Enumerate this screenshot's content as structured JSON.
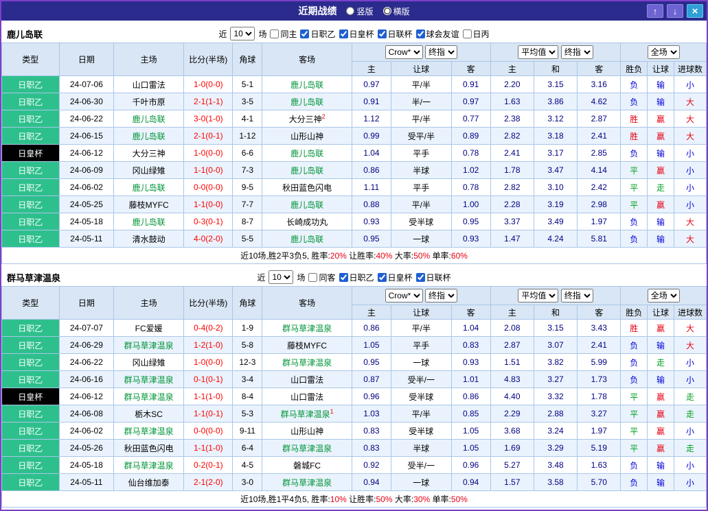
{
  "titlebar": {
    "title": "近期战绩",
    "radios": [
      {
        "label": "竖版",
        "checked": false
      },
      {
        "label": "横版",
        "checked": true
      }
    ],
    "buttons": [
      {
        "name": "up",
        "glyph": "↑"
      },
      {
        "name": "down",
        "glyph": "↓"
      },
      {
        "name": "close",
        "glyph": "×"
      }
    ]
  },
  "filter_labels": {
    "near": "近",
    "games": "场"
  },
  "table_header": {
    "type": "类型",
    "date": "日期",
    "home": "主场",
    "score": "比分(半场)",
    "corner": "角球",
    "away": "客场",
    "asian_selects": [
      "Crow*",
      "终指"
    ],
    "euro_selects": [
      "平均值",
      "终指"
    ],
    "scope_select": "全场",
    "sub": [
      "主",
      "让球",
      "客",
      "主",
      "和",
      "客",
      "胜负",
      "让球",
      "进球数"
    ]
  },
  "colors": {
    "accent_green": "#2ec08c",
    "cup_black": "#000000",
    "win_red": "#e60012",
    "lose_blue": "#0000d8",
    "draw_green": "#00a020",
    "titlebar_bg": "#2b2b8e"
  },
  "sections": [
    {
      "team": "鹿儿岛联",
      "count": "10",
      "same": {
        "label": "同主",
        "checked": false
      },
      "leagues": [
        {
          "label": "日职乙",
          "checked": true
        },
        {
          "label": "日皇杯",
          "checked": true
        },
        {
          "label": "日联杯",
          "checked": true
        },
        {
          "label": "球会友谊",
          "checked": true
        },
        {
          "label": "日丙",
          "checked": false
        }
      ],
      "rows": [
        {
          "league": "日职乙",
          "date": "24-07-06",
          "home": "山口雷法",
          "home_focus": false,
          "home_sup": "",
          "score": "1-0(0-0)",
          "corner": "5-1",
          "away": "鹿儿岛联",
          "away_focus": true,
          "away_sup": "",
          "asian": [
            "0.97",
            "平/半",
            "0.91"
          ],
          "euro": [
            "2.20",
            "3.15",
            "3.16"
          ],
          "result": "负",
          "handicap_result": "输",
          "goals": "小"
        },
        {
          "league": "日职乙",
          "date": "24-06-30",
          "home": "千叶市原",
          "home_focus": false,
          "home_sup": "",
          "score": "2-1(1-1)",
          "corner": "3-5",
          "away": "鹿儿岛联",
          "away_focus": true,
          "away_sup": "",
          "asian": [
            "0.91",
            "半/一",
            "0.97"
          ],
          "euro": [
            "1.63",
            "3.86",
            "4.62"
          ],
          "result": "负",
          "handicap_result": "输",
          "goals": "大"
        },
        {
          "league": "日职乙",
          "date": "24-06-22",
          "home": "鹿儿岛联",
          "home_focus": true,
          "home_sup": "",
          "score": "3-0(1-0)",
          "corner": "4-1",
          "away": "大分三神",
          "away_focus": false,
          "away_sup": "2",
          "asian": [
            "1.12",
            "平/半",
            "0.77"
          ],
          "euro": [
            "2.38",
            "3.12",
            "2.87"
          ],
          "result": "胜",
          "handicap_result": "赢",
          "goals": "大"
        },
        {
          "league": "日职乙",
          "date": "24-06-15",
          "home": "鹿儿岛联",
          "home_focus": true,
          "home_sup": "",
          "score": "2-1(0-1)",
          "corner": "1-12",
          "away": "山形山神",
          "away_focus": false,
          "away_sup": "",
          "asian": [
            "0.99",
            "受平/半",
            "0.89"
          ],
          "euro": [
            "2.82",
            "3.18",
            "2.41"
          ],
          "result": "胜",
          "handicap_result": "赢",
          "goals": "大"
        },
        {
          "league": "日皇杯",
          "date": "24-06-12",
          "home": "大分三神",
          "home_focus": false,
          "home_sup": "",
          "score": "1-0(0-0)",
          "corner": "6-6",
          "away": "鹿儿岛联",
          "away_focus": true,
          "away_sup": "",
          "asian": [
            "1.04",
            "平手",
            "0.78"
          ],
          "euro": [
            "2.41",
            "3.17",
            "2.85"
          ],
          "result": "负",
          "handicap_result": "输",
          "goals": "小"
        },
        {
          "league": "日职乙",
          "date": "24-06-09",
          "home": "冈山绿雉",
          "home_focus": false,
          "home_sup": "",
          "score": "1-1(0-0)",
          "corner": "7-3",
          "away": "鹿儿岛联",
          "away_focus": true,
          "away_sup": "",
          "asian": [
            "0.86",
            "半球",
            "1.02"
          ],
          "euro": [
            "1.78",
            "3.47",
            "4.14"
          ],
          "result": "平",
          "handicap_result": "赢",
          "goals": "小"
        },
        {
          "league": "日职乙",
          "date": "24-06-02",
          "home": "鹿儿岛联",
          "home_focus": true,
          "home_sup": "",
          "score": "0-0(0-0)",
          "corner": "9-5",
          "away": "秋田蓝色闪电",
          "away_focus": false,
          "away_sup": "",
          "asian": [
            "1.11",
            "平手",
            "0.78"
          ],
          "euro": [
            "2.82",
            "3.10",
            "2.42"
          ],
          "result": "平",
          "handicap_result": "走",
          "goals": "小"
        },
        {
          "league": "日职乙",
          "date": "24-05-25",
          "home": "藤枝MYFC",
          "home_focus": false,
          "home_sup": "",
          "score": "1-1(0-0)",
          "corner": "7-7",
          "away": "鹿儿岛联",
          "away_focus": true,
          "away_sup": "",
          "asian": [
            "0.88",
            "平/半",
            "1.00"
          ],
          "euro": [
            "2.28",
            "3.19",
            "2.98"
          ],
          "result": "平",
          "handicap_result": "赢",
          "goals": "小"
        },
        {
          "league": "日职乙",
          "date": "24-05-18",
          "home": "鹿儿岛联",
          "home_focus": true,
          "home_sup": "",
          "score": "0-3(0-1)",
          "corner": "8-7",
          "away": "长崎成功丸",
          "away_focus": false,
          "away_sup": "",
          "asian": [
            "0.93",
            "受半球",
            "0.95"
          ],
          "euro": [
            "3.37",
            "3.49",
            "1.97"
          ],
          "result": "负",
          "handicap_result": "输",
          "goals": "大"
        },
        {
          "league": "日职乙",
          "date": "24-05-11",
          "home": "清水鼓动",
          "home_focus": false,
          "home_sup": "",
          "score": "4-0(2-0)",
          "corner": "5-5",
          "away": "鹿儿岛联",
          "away_focus": true,
          "away_sup": "",
          "asian": [
            "0.95",
            "一球",
            "0.93"
          ],
          "euro": [
            "1.47",
            "4.24",
            "5.81"
          ],
          "result": "负",
          "handicap_result": "输",
          "goals": "大"
        }
      ],
      "summary": {
        "prefix": "近10场,胜2平3负5,",
        "stats": [
          {
            "label": "胜率:",
            "value": "20%"
          },
          {
            "label": " 让胜率:",
            "value": "40%"
          },
          {
            "label": " 大率:",
            "value": "50%"
          },
          {
            "label": " 单率:",
            "value": "60%"
          }
        ]
      }
    },
    {
      "team": "群马草津温泉",
      "count": "10",
      "same": {
        "label": "同客",
        "checked": false
      },
      "leagues": [
        {
          "label": "日职乙",
          "checked": true
        },
        {
          "label": "日皇杯",
          "checked": true
        },
        {
          "label": "日联杯",
          "checked": true
        }
      ],
      "rows": [
        {
          "league": "日职乙",
          "date": "24-07-07",
          "home": "FC爱媛",
          "home_focus": false,
          "home_sup": "",
          "score": "0-4(0-2)",
          "corner": "1-9",
          "away": "群马草津温泉",
          "away_focus": true,
          "away_sup": "",
          "asian": [
            "0.86",
            "平/半",
            "1.04"
          ],
          "euro": [
            "2.08",
            "3.15",
            "3.43"
          ],
          "result": "胜",
          "handicap_result": "赢",
          "goals": "大"
        },
        {
          "league": "日职乙",
          "date": "24-06-29",
          "home": "群马草津温泉",
          "home_focus": true,
          "home_sup": "",
          "score": "1-2(1-0)",
          "corner": "5-8",
          "away": "藤枝MYFC",
          "away_focus": false,
          "away_sup": "",
          "asian": [
            "1.05",
            "平手",
            "0.83"
          ],
          "euro": [
            "2.87",
            "3.07",
            "2.41"
          ],
          "result": "负",
          "handicap_result": "输",
          "goals": "大"
        },
        {
          "league": "日职乙",
          "date": "24-06-22",
          "home": "冈山绿雉",
          "home_focus": false,
          "home_sup": "",
          "score": "1-0(0-0)",
          "corner": "12-3",
          "away": "群马草津温泉",
          "away_focus": true,
          "away_sup": "",
          "asian": [
            "0.95",
            "一球",
            "0.93"
          ],
          "euro": [
            "1.51",
            "3.82",
            "5.99"
          ],
          "result": "负",
          "handicap_result": "走",
          "goals": "小"
        },
        {
          "league": "日职乙",
          "date": "24-06-16",
          "home": "群马草津温泉",
          "home_focus": true,
          "home_sup": "",
          "score": "0-1(0-1)",
          "corner": "3-4",
          "away": "山口雷法",
          "away_focus": false,
          "away_sup": "",
          "asian": [
            "0.87",
            "受半/一",
            "1.01"
          ],
          "euro": [
            "4.83",
            "3.27",
            "1.73"
          ],
          "result": "负",
          "handicap_result": "输",
          "goals": "小"
        },
        {
          "league": "日皇杯",
          "date": "24-06-12",
          "home": "群马草津温泉",
          "home_focus": true,
          "home_sup": "",
          "score": "1-1(1-0)",
          "corner": "8-4",
          "away": "山口雷法",
          "away_focus": false,
          "away_sup": "",
          "asian": [
            "0.96",
            "受半球",
            "0.86"
          ],
          "euro": [
            "4.40",
            "3.32",
            "1.78"
          ],
          "result": "平",
          "handicap_result": "赢",
          "goals": "走"
        },
        {
          "league": "日职乙",
          "date": "24-06-08",
          "home": "栃木SC",
          "home_focus": false,
          "home_sup": "",
          "score": "1-1(0-1)",
          "corner": "5-3",
          "away": "群马草津温泉",
          "away_focus": true,
          "away_sup": "1",
          "asian": [
            "1.03",
            "平/半",
            "0.85"
          ],
          "euro": [
            "2.29",
            "2.88",
            "3.27"
          ],
          "result": "平",
          "handicap_result": "赢",
          "goals": "走"
        },
        {
          "league": "日职乙",
          "date": "24-06-02",
          "home": "群马草津温泉",
          "home_focus": true,
          "home_sup": "",
          "score": "0-0(0-0)",
          "corner": "9-11",
          "away": "山形山神",
          "away_focus": false,
          "away_sup": "",
          "asian": [
            "0.83",
            "受半球",
            "1.05"
          ],
          "euro": [
            "3.68",
            "3.24",
            "1.97"
          ],
          "result": "平",
          "handicap_result": "赢",
          "goals": "小"
        },
        {
          "league": "日职乙",
          "date": "24-05-26",
          "home": "秋田蓝色闪电",
          "home_focus": false,
          "home_sup": "",
          "score": "1-1(1-0)",
          "corner": "6-4",
          "away": "群马草津温泉",
          "away_focus": true,
          "away_sup": "",
          "asian": [
            "0.83",
            "半球",
            "1.05"
          ],
          "euro": [
            "1.69",
            "3.29",
            "5.19"
          ],
          "result": "平",
          "handicap_result": "赢",
          "goals": "走"
        },
        {
          "league": "日职乙",
          "date": "24-05-18",
          "home": "群马草津温泉",
          "home_focus": true,
          "home_sup": "",
          "score": "0-2(0-1)",
          "corner": "4-5",
          "away": "磐城FC",
          "away_focus": false,
          "away_sup": "",
          "asian": [
            "0.92",
            "受半/一",
            "0.96"
          ],
          "euro": [
            "5.27",
            "3.48",
            "1.63"
          ],
          "result": "负",
          "handicap_result": "输",
          "goals": "小"
        },
        {
          "league": "日职乙",
          "date": "24-05-11",
          "home": "仙台维加泰",
          "home_focus": false,
          "home_sup": "",
          "score": "2-1(2-0)",
          "corner": "3-0",
          "away": "群马草津温泉",
          "away_focus": true,
          "away_sup": "",
          "asian": [
            "0.94",
            "一球",
            "0.94"
          ],
          "euro": [
            "1.57",
            "3.58",
            "5.70"
          ],
          "result": "负",
          "handicap_result": "输",
          "goals": "小"
        }
      ],
      "summary": {
        "prefix": "近10场,胜1平4负5,",
        "stats": [
          {
            "label": "胜率:",
            "value": "10%"
          },
          {
            "label": " 让胜率:",
            "value": "50%"
          },
          {
            "label": " 大率:",
            "value": "30%"
          },
          {
            "label": " 单率:",
            "value": "50%"
          }
        ]
      }
    }
  ]
}
